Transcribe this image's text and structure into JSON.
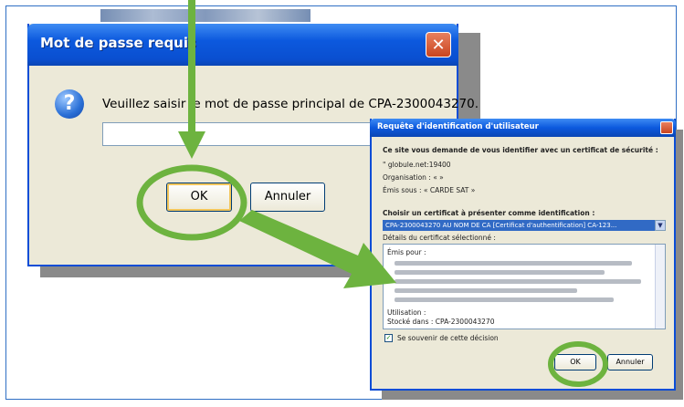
{
  "dialog_password": {
    "title": "Mot de passe requis",
    "message": "Veuillez saisir le mot de passe principal de CPA-2300043270.",
    "password_value": "",
    "ok_label": "OK",
    "cancel_label": "Annuler"
  },
  "dialog_identify": {
    "title": "Requête d'identification d'utilisateur",
    "intro": "Ce site vous demande de vous identifier avec un certificat de sécurité :",
    "host": "\" globule.net:19400",
    "organization": "Organisation : « »",
    "issued_by": "Émis sous : « CARDE SAT »",
    "choose_label": "Choisir un certificat à présenter comme identification :",
    "selected_certificate": "CPA-2300043270 AU NOM DE CA [Certificat d'authentification] CA-123...",
    "details_label": "Détails du certificat sélectionné :",
    "details_first": "Émis pour :",
    "details_footer_1": "Utilisation :",
    "details_footer_2": "Stocké dans : CPA-2300043270",
    "remember_label": "Se souvenir de cette décision",
    "ok_label": "OK",
    "cancel_label": "Annuler"
  },
  "annotation_colors": {
    "highlight": "#6db33f"
  }
}
